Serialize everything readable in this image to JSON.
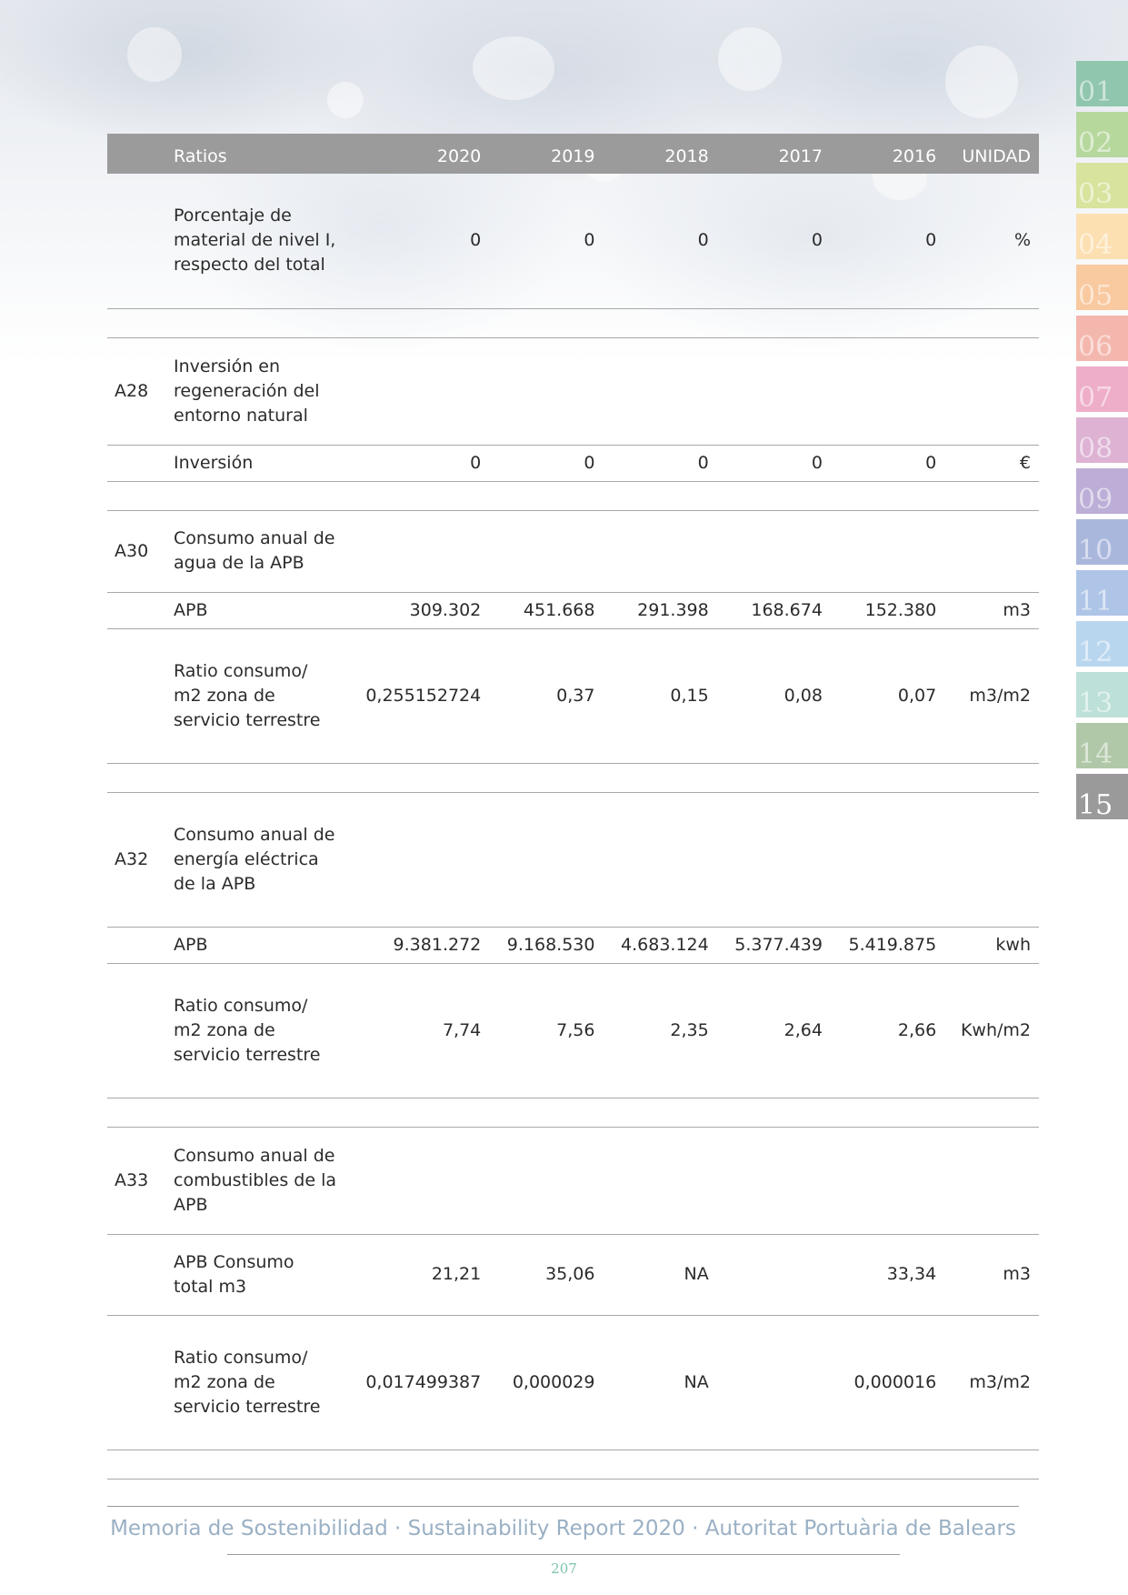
{
  "colors": {
    "header_bg": "#9b9b9b",
    "footer_text": "#9ab0c4",
    "page_number": "#7ec2a8",
    "tabs": [
      "#8fc6ad",
      "#b6d89d",
      "#d8e39e",
      "#fce0b2",
      "#f9c9a0",
      "#f4b7ae",
      "#eeaec9",
      "#ddb2d3",
      "#bcaed6",
      "#aab7dd",
      "#aec5e7",
      "#b9d6ef",
      "#bde0d8",
      "#b0c8a8",
      "#9a9a9a"
    ]
  },
  "tabs": [
    "01",
    "02",
    "03",
    "04",
    "05",
    "06",
    "07",
    "08",
    "09",
    "10",
    "11",
    "12",
    "13",
    "14",
    "15"
  ],
  "active_tab": "15",
  "table": {
    "headers": [
      "Ratios",
      "2020",
      "2019",
      "2018",
      "2017",
      "2016",
      "UNIDAD"
    ],
    "rows": [
      {
        "type": "data",
        "code": "",
        "label": "Porcentaje de material de nivel I, respecto del total",
        "values": [
          "0",
          "0",
          "0",
          "0",
          "0"
        ],
        "unit": "%"
      },
      {
        "type": "spacer"
      },
      {
        "type": "section",
        "code": "A28",
        "label": "Inversión en regeneración del entorno natural"
      },
      {
        "type": "data",
        "code": "",
        "label": "Inversión",
        "values": [
          "0",
          "0",
          "0",
          "0",
          "0"
        ],
        "unit": "€"
      },
      {
        "type": "spacer"
      },
      {
        "type": "section",
        "code": "A30",
        "label": "Consumo anual de agua de la APB"
      },
      {
        "type": "data",
        "code": "",
        "label": "APB",
        "values": [
          "309.302",
          "451.668",
          "291.398",
          "168.674",
          "152.380"
        ],
        "unit": "m3"
      },
      {
        "type": "data",
        "code": "",
        "label": "Ratio consumo/ m2 zona de servicio terrestre",
        "values": [
          "0,255152724",
          "0,37",
          "0,15",
          "0,08",
          "0,07"
        ],
        "unit": "m3/m2"
      },
      {
        "type": "spacer"
      },
      {
        "type": "section",
        "code": "A32",
        "label": "Consumo anual de energía eléctrica de la APB"
      },
      {
        "type": "data",
        "code": "",
        "label": "APB",
        "values": [
          "9.381.272",
          "9.168.530",
          "4.683.124",
          "5.377.439",
          "5.419.875"
        ],
        "unit": "kwh"
      },
      {
        "type": "data",
        "code": "",
        "label": "Ratio consumo/ m2 zona de servicio terrestre",
        "values": [
          "7,74",
          "7,56",
          "2,35",
          "2,64",
          "2,66"
        ],
        "unit": "Kwh/m2"
      },
      {
        "type": "spacer"
      },
      {
        "type": "section",
        "code": "A33",
        "label": "Consumo anual de combustibles de la APB"
      },
      {
        "type": "data",
        "code": "",
        "label": "APB Consumo total m3",
        "values": [
          "21,21",
          "35,06",
          "NA",
          "",
          "33,34"
        ],
        "unit": "m3"
      },
      {
        "type": "data",
        "code": "",
        "label": "Ratio consumo/ m2 zona de servicio terrestre",
        "values": [
          "0,017499387",
          "0,000029",
          "NA",
          "",
          "0,000016"
        ],
        "unit": "m3/m2"
      },
      {
        "type": "spacer"
      }
    ]
  },
  "footer": {
    "text": "Memoria de Sostenibilidad · Sustainability Report 2020 · Autoritat Portuària de Balears",
    "page_number": "207"
  }
}
